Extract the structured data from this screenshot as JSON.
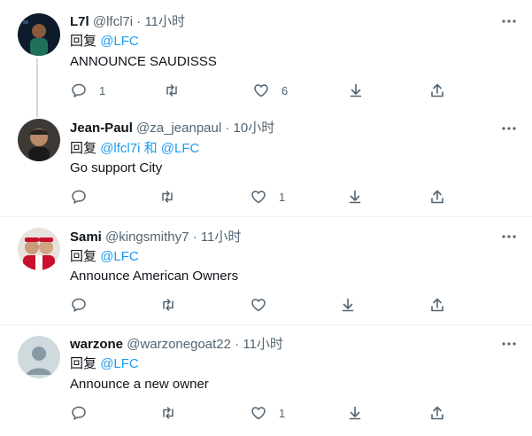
{
  "tweets": [
    {
      "name": "L7l",
      "handle": "@lfcl7i",
      "dot": "·",
      "time": "11小时",
      "reply_prefix": "回复",
      "reply_to": "@LFC",
      "text": "ANNOUNCE SAUDISSS",
      "replies": "1",
      "retweets": "",
      "likes": "6"
    },
    {
      "name": "Jean-Paul",
      "handle": "@za_jeanpaul",
      "dot": "·",
      "time": "10小时",
      "reply_prefix": "回复",
      "reply_to": "@lfcl7i 和 @LFC",
      "text": "Go support City",
      "replies": "",
      "retweets": "",
      "likes": "1"
    },
    {
      "name": "Sami",
      "handle": "@kingsmithy7",
      "dot": "·",
      "time": "11小时",
      "reply_prefix": "回复",
      "reply_to": "@LFC",
      "text": "Announce American Owners",
      "replies": "",
      "retweets": "",
      "likes": ""
    },
    {
      "name": "warzone",
      "handle": "@warzonegoat22",
      "dot": "·",
      "time": "11小时",
      "reply_prefix": "回复",
      "reply_to": "@LFC",
      "text": "Announce a new owner",
      "replies": "",
      "retweets": "",
      "likes": "1"
    }
  ],
  "icons": {
    "more": "more-dots-icon",
    "reply": "reply-icon",
    "retweet": "retweet-icon",
    "like": "heart-icon",
    "download": "download-icon",
    "share": "share-icon"
  },
  "colors": {
    "mention": "#1d9bf0",
    "secondary_text": "#536471",
    "divider": "#eff3f4",
    "thread_line": "#cfd9de"
  }
}
